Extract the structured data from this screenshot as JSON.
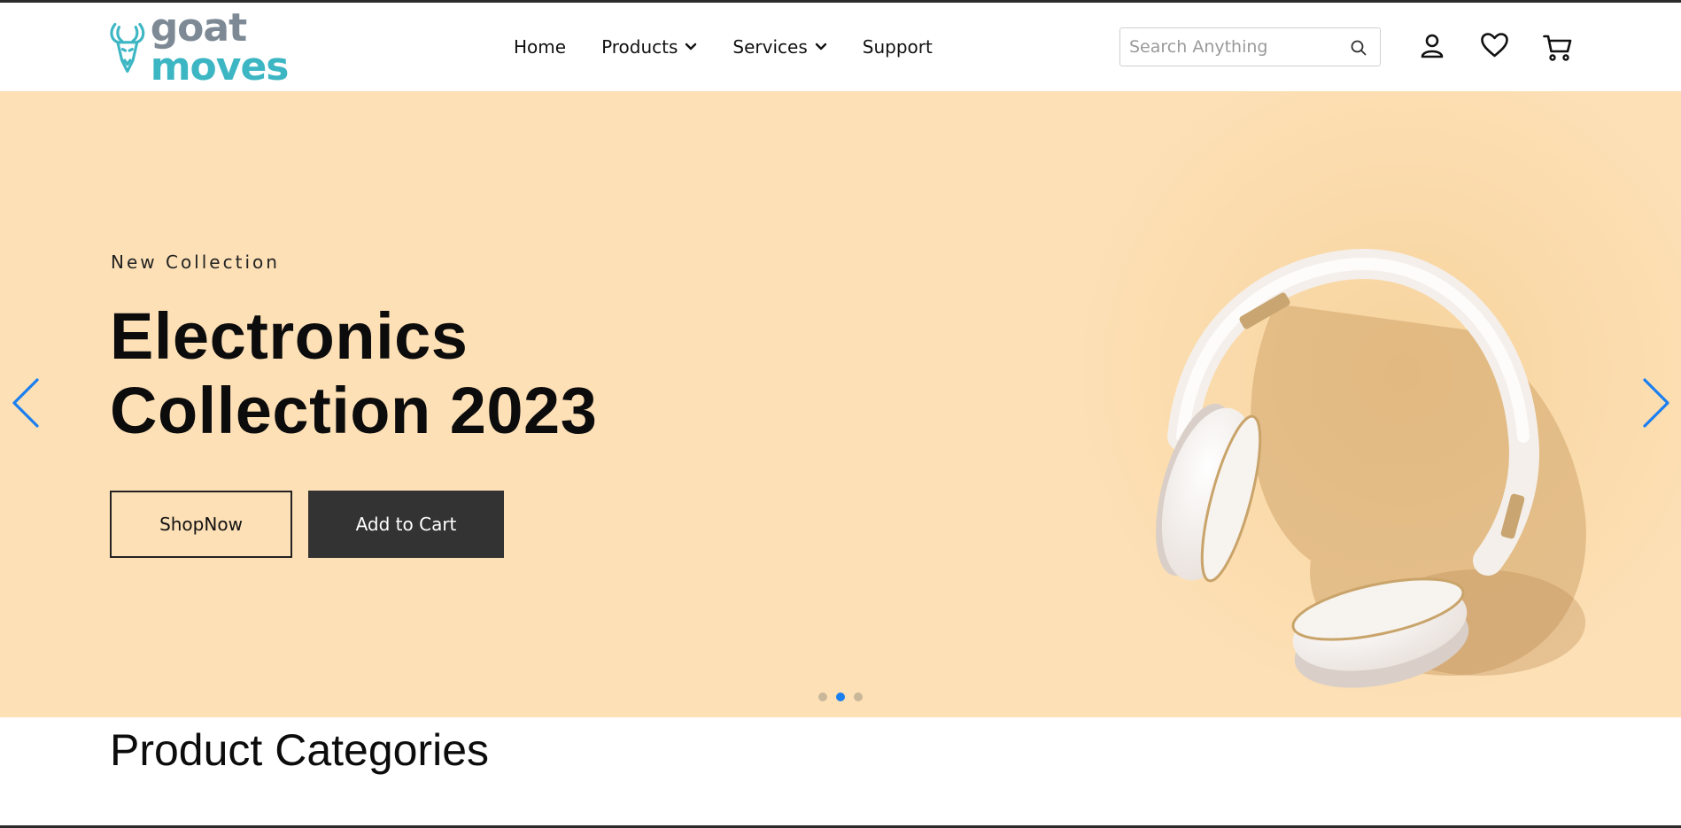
{
  "header": {
    "logo": {
      "word1": "goat",
      "word2": "moves"
    },
    "nav": [
      {
        "label": "Home",
        "has_dropdown": false
      },
      {
        "label": "Products",
        "has_dropdown": true
      },
      {
        "label": "Services",
        "has_dropdown": true
      },
      {
        "label": "Support",
        "has_dropdown": false
      }
    ],
    "search": {
      "placeholder": "Search Anything",
      "value": ""
    },
    "icons": [
      "user-icon",
      "heart-icon",
      "cart-icon"
    ]
  },
  "hero": {
    "eyebrow": "New Collection",
    "headline_line1": "Electronics",
    "headline_line2": "Collection 2023",
    "shop_button": "ShopNow",
    "cart_button": "Add to Cart",
    "slide_count": 3,
    "active_slide": 2,
    "background_color": "#fde0b6",
    "arrow_color": "#1a7ff0"
  },
  "section": {
    "title": "Product Categories"
  }
}
